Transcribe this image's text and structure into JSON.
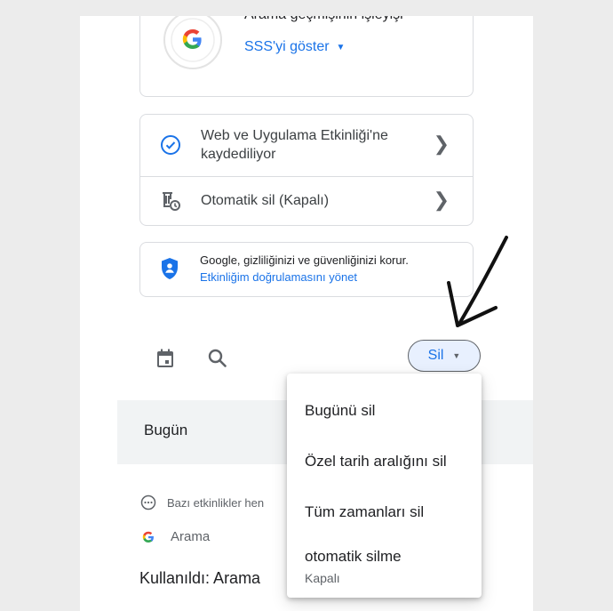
{
  "history_card": {
    "title": "Arama geçmişinin işleyişi",
    "faq_link": "SSS'yi göster"
  },
  "settings": [
    {
      "icon": "check-circle-icon",
      "line1": "Web ve Uygulama Etkinliği'ne",
      "line2": "kaydediliyor"
    },
    {
      "icon": "auto-delete-icon",
      "line1": "Otomatik sil (Kapalı)"
    }
  ],
  "protection": {
    "text": "Google, gizliliğinizi ve güvenliğinizi korur.",
    "link": "Etkinliğim doğrulamasını yönet"
  },
  "toolbar": {
    "delete_label": "Sil"
  },
  "today": {
    "label": "Bugün"
  },
  "activity": {
    "notice": "Bazı etkinlikler hen",
    "source": "Arama",
    "used": "Kullanıldı: Arama"
  },
  "delete_menu": {
    "items": [
      "Bugünü sil",
      "Özel tarih aralığını sil",
      "Tüm zamanları sil",
      "otomatik silme"
    ],
    "auto_delete_status": "Kapalı"
  },
  "colors": {
    "accent": "#1a73e8",
    "button_bg": "#e8f0fe",
    "band": "#f1f3f4"
  }
}
